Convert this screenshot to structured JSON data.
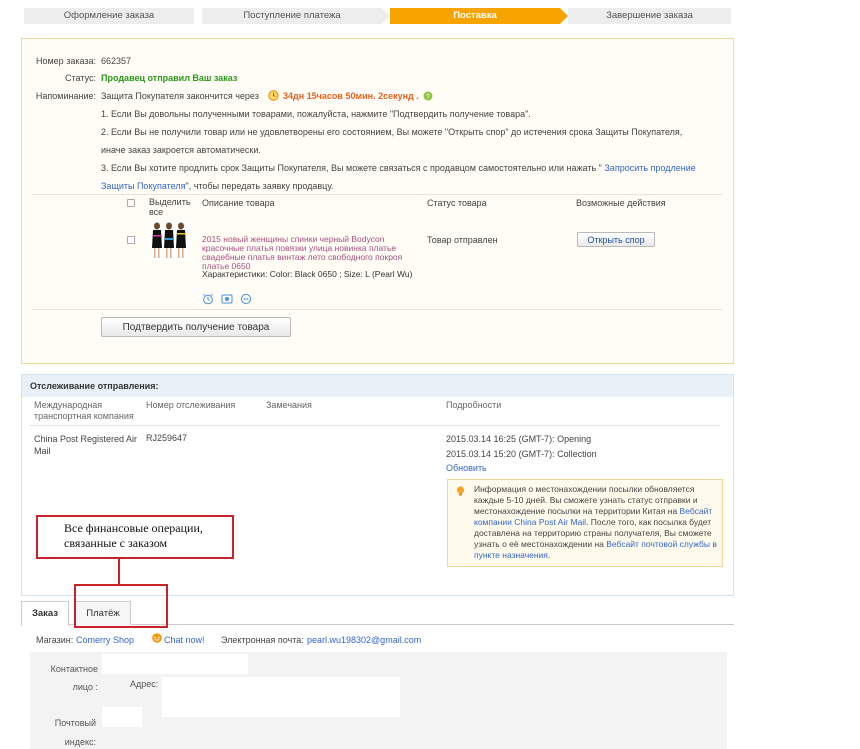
{
  "steps": [
    "Оформление заказа",
    "Поступление платежа",
    "Поставка",
    "Завершение заказа"
  ],
  "order": {
    "number_label": "Номер заказа:",
    "number_value": "662357",
    "status_label": "Статус:",
    "status_value": "Продавец отправил Ваш заказ",
    "reminder_label": "Напоминание:",
    "reminder_text": "Защита Покупателя закончится через",
    "countdown": "34дн 15часов 50мин. 2секунд .",
    "note1": "1. Если Вы довольны полученными товарами, пожалуйста, нажмите \"Подтвердить получение товара\".",
    "note2a": "2. Если Вы не получили товар или не удовлетворены его состоянием, Вы можете \"Открыть спор\" до истечения срока Защиты Покупателя,",
    "note2b": "иначе заказ закроется автоматически.",
    "note3a_pre": "3. Если Вы хотите продлить срок Защиты Покупателя, Вы можете связаться с продавцом самостоятельно или нажать \"",
    "note3a_link": "Запросить продление",
    "note3b_link": "Защиты Покупателя",
    "note3b_post": "\", чтобы передать заявку продавцу.",
    "col_select": "Выделить все",
    "col_desc": "Описание товара",
    "col_status": "Статус товара",
    "col_actions": "Возможные действия",
    "product_title": "2015 новый женщины спинки черный Bodycon красочные платья повязки улица новинка платье свадебные платья винтаж лето свободного покроя платье 0650",
    "product_attrs": "Характеристики: Color: Black 0650    ; Size: L (Pearl Wu)",
    "product_status": "Товар отправлен",
    "dispute_button": "Открыть спор",
    "confirm_button": "Подтвердить получение товара"
  },
  "tracking": {
    "header": "Отслеживание отправления:",
    "col_company": "Международная транспортная компания",
    "col_number": "Номер отслеживания",
    "col_remarks": "Замечания",
    "col_details": "Подробности",
    "company": "China Post Registered Air Mail",
    "number": "RJ259647",
    "event1": "2015.03.14 16:25 (GMT-7): Opening",
    "event2": "2015.03.14 15:20 (GMT-7): Collection",
    "refresh": "Обновить",
    "info_part1": "Информация о местонахождении посылки обновляется каждые 5-10 дней. Вы сможете узнать статус отправки и местонахождение посылки на территории Китая на",
    "info_link1": "Вебсайт компании China Post Air Mail",
    "info_part2": ". После того, как посылка будет доставлена на территорию страны получателя, Вы сможете узнать о её местонахождении на",
    "info_link2": "Вебсайт почтовой службы в пункте назначения",
    "info_part3": "."
  },
  "annotation": "Все финансовые операции, связанные с заказом",
  "tabs": [
    "Заказ",
    "Платёж"
  ],
  "store": {
    "shop_label": "Магазин:",
    "shop_name": "Comerry Shop",
    "chat": "Chat now!",
    "email_label": "Электронная почта:",
    "email": "pearl.wu198302@gmail.com",
    "contact_label": "Контактное лицо :",
    "address_label": "Адрес:",
    "zip_label": "Почтовый индекс:"
  },
  "colors": {
    "accent_orange": "#f7a400",
    "status_green": "#2a9a1a",
    "link_blue": "#3366cc",
    "annotation_red": "#c8232c"
  }
}
